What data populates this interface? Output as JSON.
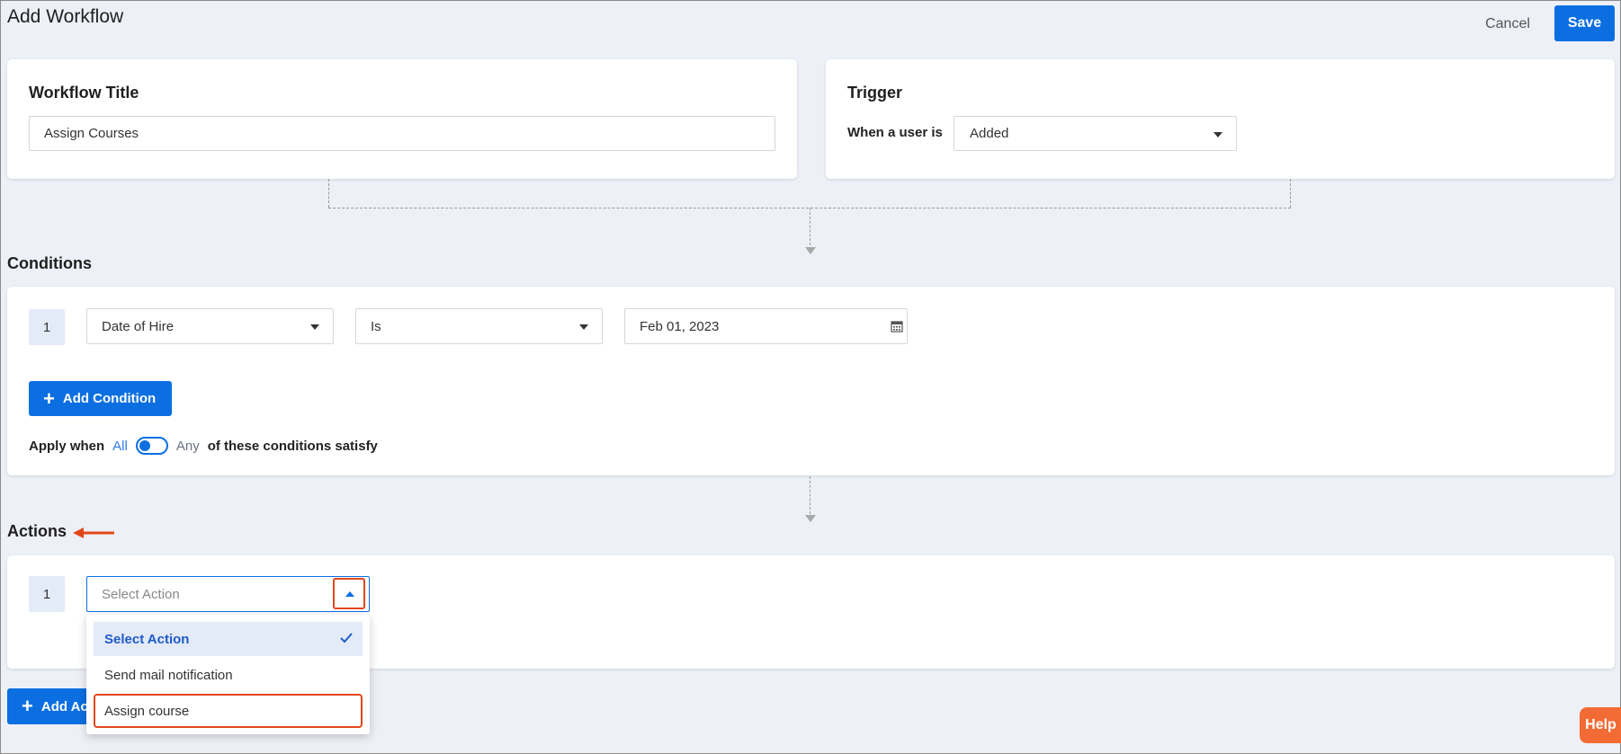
{
  "header": {
    "title": "Add Workflow",
    "cancel_label": "Cancel",
    "save_label": "Save"
  },
  "workflow_title_card": {
    "heading": "Workflow Title",
    "input_value": "Assign Courses"
  },
  "trigger_card": {
    "heading": "Trigger",
    "label": "When a user is",
    "selected": "Added"
  },
  "conditions": {
    "heading": "Conditions",
    "rows": [
      {
        "number": "1",
        "field": "Date of Hire",
        "operator": "Is",
        "value": "Feb 01, 2023"
      }
    ],
    "add_button_label": "Add Condition",
    "apply_when": "Apply when",
    "all_label": "All",
    "any_label": "Any",
    "suffix": "of these conditions satisfy"
  },
  "actions": {
    "heading": "Actions",
    "rows": [
      {
        "number": "1",
        "placeholder": "Select Action"
      }
    ],
    "add_button_label": "Add Ac",
    "dropdown_options": [
      {
        "label": "Select Action",
        "selected": true
      },
      {
        "label": "Send mail notification",
        "selected": false
      },
      {
        "label": "Assign course",
        "selected": false,
        "highlighted": true
      }
    ]
  },
  "help": {
    "label": "Help"
  },
  "colors": {
    "primary": "#0b6fe1",
    "highlight": "#e2471a",
    "help": "#f26b34",
    "background": "#eef0f7"
  }
}
